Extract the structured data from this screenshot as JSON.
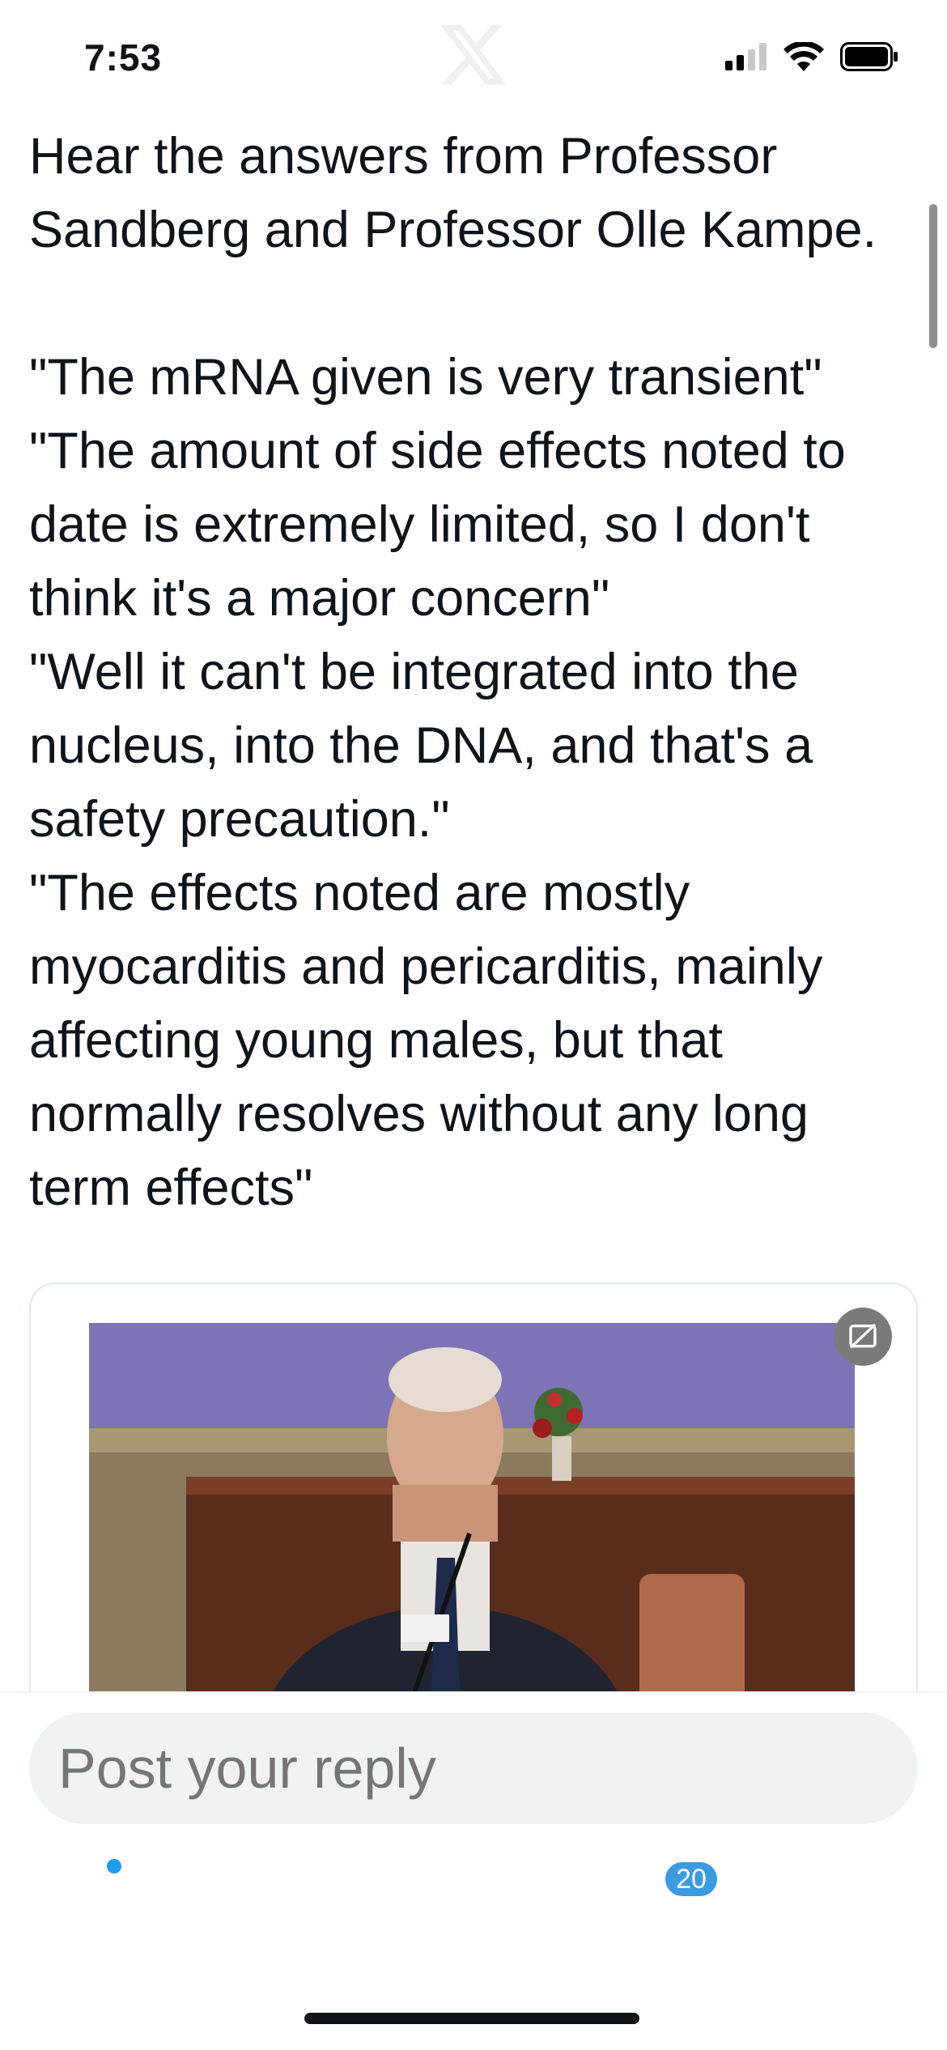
{
  "status_bar": {
    "time": "7:53"
  },
  "tweet": {
    "text": "Hear the answers from Professor\nSandberg and Professor Olle Kampe.\n\n\"The mRNA given is very transient\"\n\"The amount of side effects noted to\ndate is extremely limited, so I don't\nthink it's a major concern\"\n\"Well it can't be integrated into the\nnucleus, into the DNA, and that's a\nsafety precaution.\"\n\"The effects noted are mostly\nmyocarditis and pericarditis, mainly\naffecting young males, but that\nnormally resolves without any long\nterm effects\""
  },
  "reply": {
    "placeholder": "Post your reply"
  },
  "tab_bar": {
    "items": [
      {
        "icon": "home-icon"
      },
      {
        "icon": "search-icon"
      },
      {
        "icon": "communities-icon"
      },
      {
        "icon": "notifications-icon"
      },
      {
        "icon": "messages-icon"
      }
    ],
    "notifications_count": "20"
  },
  "colors": {
    "accent": "#1d9bf0",
    "text": "#0f1419",
    "muted": "#536471",
    "input_bg": "#eff3f4"
  }
}
